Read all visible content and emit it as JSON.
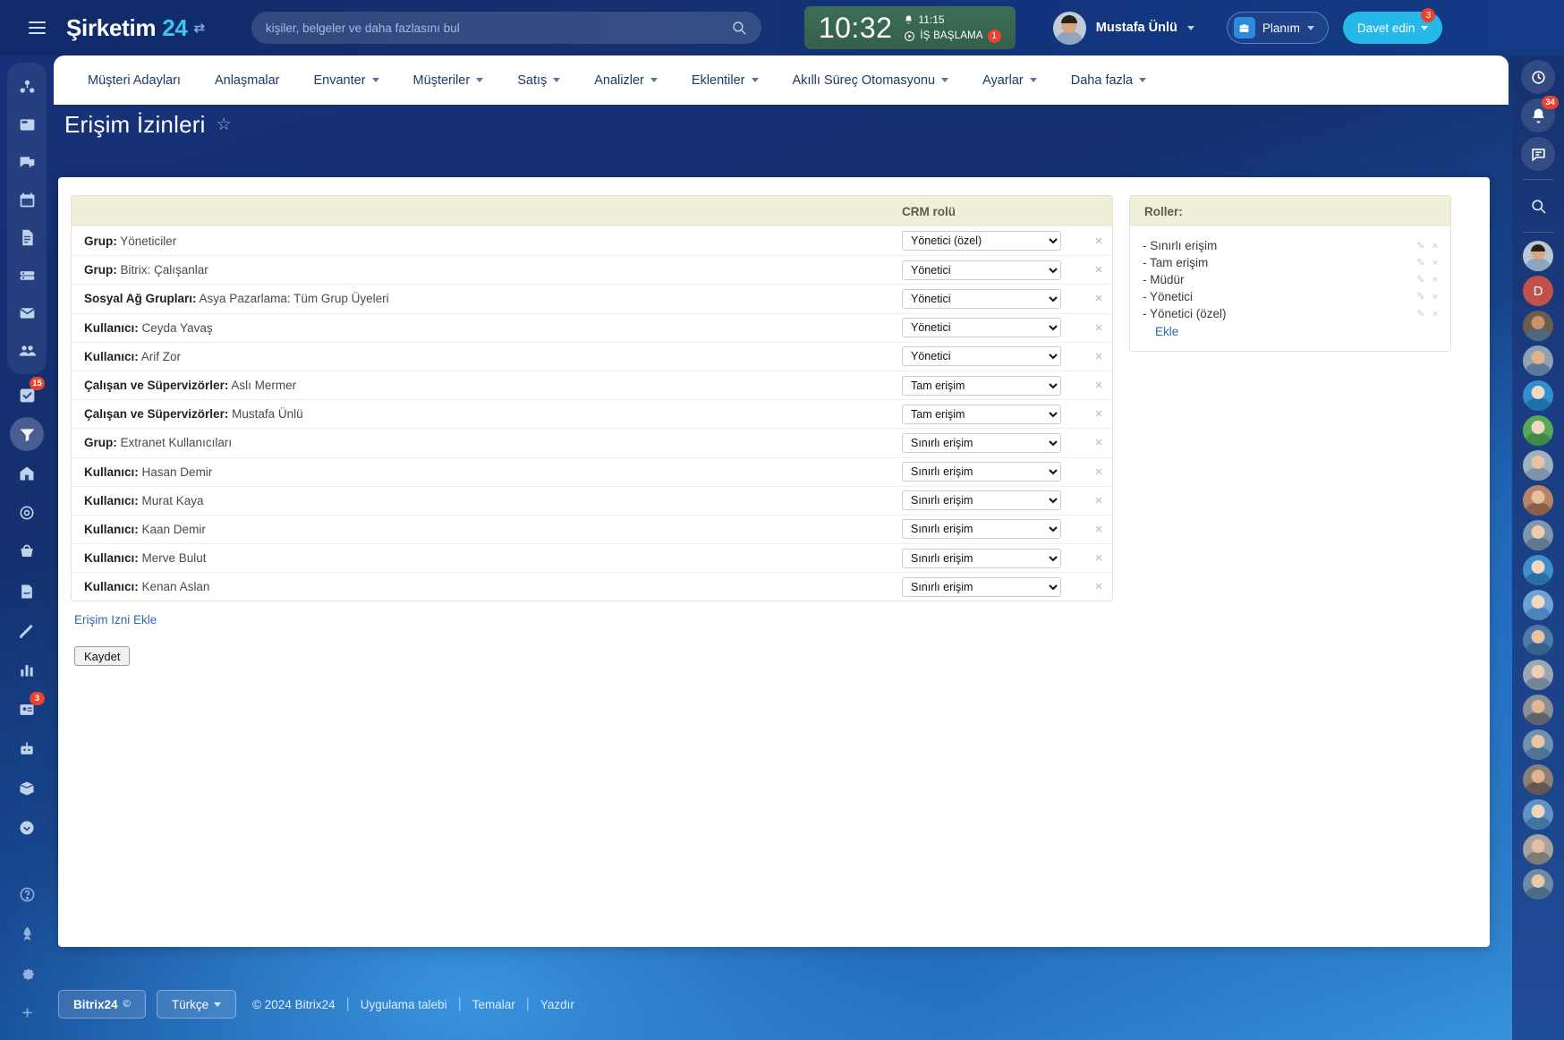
{
  "header": {
    "menu_icon": "hamburger-icon",
    "logo_text": "Şirketim",
    "logo_number": "24",
    "logo_swap_icon": "swap-icon",
    "search": {
      "placeholder": "kişiler, belgeler ve daha fazlasını bul",
      "value": "",
      "icon": "search-icon"
    },
    "clock": {
      "time": "10:32",
      "alarm_time": "11:15",
      "alarm_icon": "bell-icon",
      "start_label": "İŞ BAŞLAMA",
      "start_icon": "play-circle-icon",
      "start_badge": "1"
    },
    "user": {
      "name": "Mustafa Ünlü",
      "avatar": "user-avatar"
    },
    "plan_button": {
      "label": "Planım",
      "icon": "briefcase-icon"
    },
    "invite_button": {
      "label": "Davet edin",
      "badge": "3"
    }
  },
  "nav": {
    "items": [
      {
        "label": "Müşteri Adayları",
        "has_caret": false
      },
      {
        "label": "Anlaşmalar",
        "has_caret": false
      },
      {
        "label": "Envanter",
        "has_caret": true
      },
      {
        "label": "Müşteriler",
        "has_caret": true
      },
      {
        "label": "Satış",
        "has_caret": true
      },
      {
        "label": "Analizler",
        "has_caret": true
      },
      {
        "label": "Eklentiler",
        "has_caret": true
      },
      {
        "label": "Akıllı Süreç Otomasyonu",
        "has_caret": true
      },
      {
        "label": "Ayarlar",
        "has_caret": true
      },
      {
        "label": "Daha fazla",
        "has_caret": true
      }
    ]
  },
  "page": {
    "title": "Erişim İzinleri",
    "favorite_icon": "star-icon"
  },
  "left_sidebar": {
    "items": [
      {
        "name": "collab-icon",
        "badge": ""
      },
      {
        "name": "news-feed-icon",
        "badge": ""
      },
      {
        "name": "chat-icon",
        "badge": ""
      },
      {
        "name": "calendar-icon",
        "badge": ""
      },
      {
        "name": "documents-icon",
        "badge": ""
      },
      {
        "name": "drive-icon",
        "badge": ""
      },
      {
        "name": "mail-icon",
        "badge": ""
      },
      {
        "name": "group-icon",
        "badge": ""
      },
      {
        "name": "tasks-icon",
        "badge": "15"
      },
      {
        "name": "crm-icon",
        "badge": ""
      },
      {
        "name": "company-icon",
        "badge": ""
      },
      {
        "name": "marketing-icon",
        "badge": ""
      },
      {
        "name": "sites-shop-icon",
        "badge": ""
      },
      {
        "name": "signature-icon",
        "badge": ""
      },
      {
        "name": "edit-icon",
        "badge": ""
      },
      {
        "name": "analytics-icon",
        "badge": ""
      },
      {
        "name": "contact-center-icon",
        "badge": "3"
      },
      {
        "name": "automation-icon",
        "badge": ""
      },
      {
        "name": "inventory-icon",
        "badge": ""
      },
      {
        "name": "more-icon",
        "badge": ""
      },
      {
        "name": "help-icon",
        "badge": ""
      },
      {
        "name": "rocket-icon",
        "badge": ""
      },
      {
        "name": "settings-icon",
        "badge": ""
      },
      {
        "name": "add-icon",
        "badge": ""
      }
    ]
  },
  "right_sidebar": {
    "help_icon": "help-question-icon",
    "items": [
      {
        "name": "time-tracker-icon",
        "badge": ""
      },
      {
        "name": "notifications-bell-icon",
        "badge": "34"
      },
      {
        "name": "messenger-icon",
        "badge": ""
      },
      {
        "name": "search-icon",
        "badge": ""
      }
    ],
    "avatar_initial": "D"
  },
  "table": {
    "header": {
      "subject_col": "",
      "role_col": "CRM rolü"
    },
    "rows": [
      {
        "type": "Grup:",
        "subject": "Yöneticiler",
        "role": "Yönetici (özel)"
      },
      {
        "type": "Grup:",
        "subject": "Bitrix: Çalışanlar",
        "role": "Yönetici"
      },
      {
        "type": "Sosyal Ağ Grupları:",
        "subject": "Asya Pazarlama: Tüm Grup Üyeleri",
        "role": "Yönetici"
      },
      {
        "type": "Kullanıcı:",
        "subject": "Ceyda Yavaş",
        "role": "Yönetici"
      },
      {
        "type": "Kullanıcı:",
        "subject": "Arif Zor",
        "role": "Yönetici"
      },
      {
        "type": "Çalışan ve Süpervizörler:",
        "subject": "Aslı Mermer",
        "role": "Tam erişim"
      },
      {
        "type": "Çalışan ve Süpervizörler:",
        "subject": "Mustafa Ünlü",
        "role": "Tam erişim"
      },
      {
        "type": "Grup:",
        "subject": "Extranet Kullanıcıları",
        "role": "Sınırlı erişim"
      },
      {
        "type": "Kullanıcı:",
        "subject": "Hasan Demir",
        "role": "Sınırlı erişim"
      },
      {
        "type": "Kullanıcı:",
        "subject": "Murat Kaya",
        "role": "Sınırlı erişim"
      },
      {
        "type": "Kullanıcı:",
        "subject": "Kaan Demir",
        "role": "Sınırlı erişim"
      },
      {
        "type": "Kullanıcı:",
        "subject": "Merve Bulut",
        "role": "Sınırlı erişim"
      },
      {
        "type": "Kullanıcı:",
        "subject": "Kenan Aslan",
        "role": "Sınırlı erişim"
      }
    ],
    "role_options": [
      "Sınırlı erişim",
      "Tam erişim",
      "Müdür",
      "Yönetici",
      "Yönetici (özel)"
    ],
    "remove_icon": "close-x-icon",
    "add_permission_link": "Erişim Izni Ekle",
    "save_button": "Kaydet"
  },
  "roles_panel": {
    "title": "Roller:",
    "items": [
      {
        "label": "- Sınırlı erişim"
      },
      {
        "label": "- Tam erişim"
      },
      {
        "label": "- Müdür"
      },
      {
        "label": "- Yönetici"
      },
      {
        "label": "- Yönetici (özel)"
      }
    ],
    "edit_icon": "pencil-icon",
    "delete_icon": "close-x-icon",
    "add_link": "Ekle"
  },
  "footer": {
    "brand": "Bitrix24",
    "brand_sup": "©",
    "language": "Türkçe",
    "copyright": "© 2024 Bitrix24",
    "links": [
      "Uygulama talebi",
      "Temalar",
      "Yazdır"
    ]
  },
  "colors": {
    "accent": "#25b8e8",
    "brand_blue": "#14306f",
    "table_header": "#f0efd8",
    "link": "#2a6aae",
    "badge_red": "#e8432f",
    "clock_green": "#3c6e55"
  }
}
